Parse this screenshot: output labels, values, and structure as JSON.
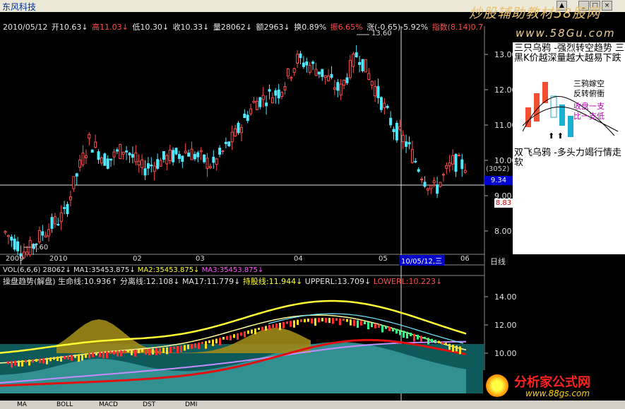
{
  "window": {
    "stock_name": "东风科技",
    "buttons": [
      "▲",
      "_",
      "□",
      "×"
    ]
  },
  "stats": {
    "date": "2010/05/12",
    "open": "开10.63↓",
    "high": "高11.03↓",
    "low": "低10.30↓",
    "close": "收10.33↓",
    "volume": "量28062↓",
    "amount": "额2963↓",
    "turnover": "换0.89%",
    "amplitude": "振6.65%",
    "change": "涨(-0.65)-5.92%",
    "index": "指数(8.14)0.7"
  },
  "price_axis": [
    "13.00",
    "12.00",
    "11.00",
    "10.00",
    "9.00",
    "8.00"
  ],
  "price_tags": {
    "code": "(3052)",
    "cross_price": "9.34",
    "last_price": "8.83"
  },
  "annotations": {
    "peak": "13.60",
    "trough": "7.60"
  },
  "x_axis": [
    "2009",
    "2010",
    "02",
    "03",
    "04",
    "05",
    "06"
  ],
  "crosshair_date": "10/05/12,三",
  "period_label": "日线",
  "volume_row": {
    "name": "VOL(6,6,6)",
    "vol": "28062↓",
    "ma1": "MA1:35453.875↓",
    "ma2": "MA2:35453.875↓",
    "ma3": "MA3:35453.875↓"
  },
  "indicator_row": {
    "name": "操盘趋势(解盘)",
    "life_line": "生命线:10.936↑",
    "split_line": "分离线:12.108↓",
    "ma17": "MA17:11.779↓",
    "hold_line": "持股线:11.944↓",
    "upperl": "UPPERL:13.709↓",
    "lowerl": "LOWERL:10.223↓"
  },
  "indicator_axis": [
    "14.00",
    "12.00",
    "10.00"
  ],
  "right_panel": {
    "pattern1": "三只乌鸦 -强烈转空趋势 三黑K价越深量越大越易下跌",
    "pattern2": "双飞乌鸦 -多头力竭行情走软",
    "legend_a": "三鸦嫁空",
    "legend_b": "反转俯衝",
    "legend_c": "收盘一支",
    "legend_d": "比一支低"
  },
  "watermark": "炒股辅助教材58股网",
  "watermark_url": "www.58Gu.com",
  "logo": {
    "name": "分析家公式网",
    "url": "www.88gs.com"
  },
  "bottom_tabs": [
    "MA",
    "BOLL",
    "MACD",
    "DST",
    "DMI"
  ],
  "colors": {
    "up": "#ff4d4d",
    "down": "#4ee8ff",
    "background": "#000000",
    "accent": "#ffff33"
  }
}
